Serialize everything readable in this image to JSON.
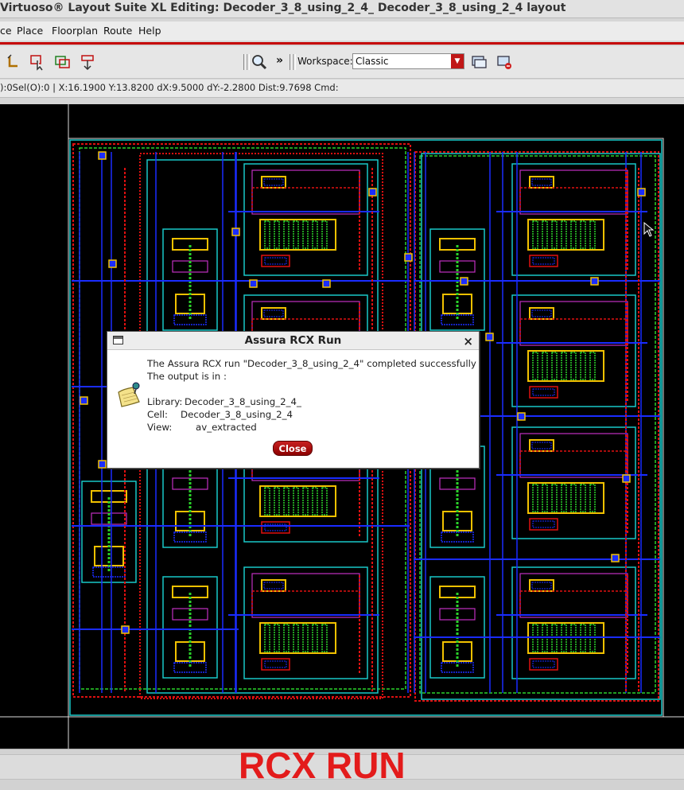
{
  "window": {
    "title": "Virtuoso® Layout Suite XL Editing: Decoder_3_8_using_2_4_ Decoder_3_8_using_2_4 layout"
  },
  "menu": {
    "items": [
      "ce",
      "Place",
      "Floorplan",
      "Route",
      "Help"
    ]
  },
  "toolbar": {
    "workspace_label": "Workspace:",
    "workspace_value": "Classic",
    "more_label": "»"
  },
  "status": {
    "text": "):0Sel(O):0 | X:16.1900 Y:13.8200 dX:9.5000 dY:-2.2800 Dist:9.7698 Cmd:"
  },
  "dialog": {
    "title": "Assura RCX Run",
    "line1": "The Assura RCX run \"Decoder_3_8_using_2_4\" completed successfully",
    "line2": "The output is in :",
    "library_label": "Library:",
    "library_value": "Decoder_3_8_using_2_4_",
    "cell_label": "Cell:",
    "cell_value": "Decoder_3_8_using_2_4",
    "view_label": "View:",
    "view_value": "av_extracted",
    "close_label": "Close",
    "close_x": "×"
  },
  "caption": "RCX RUN",
  "colors": {
    "metal1": "#1a2cff",
    "metal2": "#e01010",
    "poly": "#2ad22a",
    "diffusion": "#f2c100",
    "nwell": "#19c8c8",
    "select": "#c030c0",
    "caption": "#e31b1b"
  }
}
